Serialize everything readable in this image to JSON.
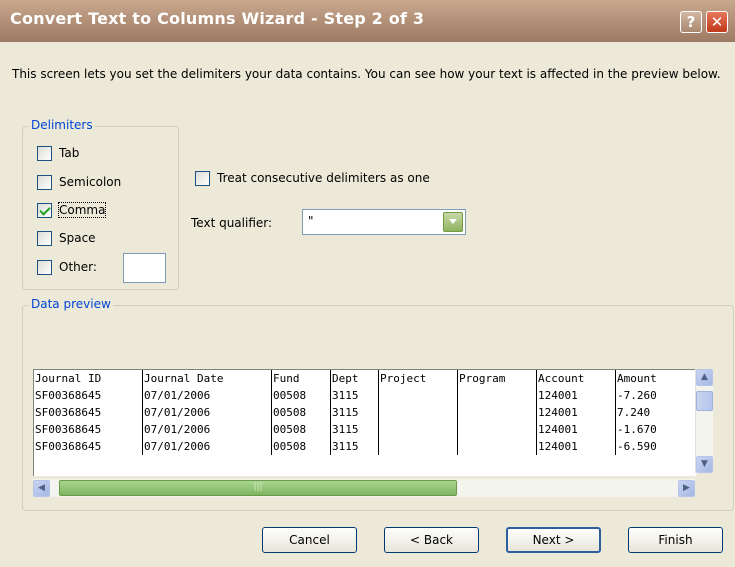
{
  "window": {
    "title": "Convert Text to Columns Wizard - Step 2 of 3",
    "help_label": "?",
    "close_label": "✕"
  },
  "intro_text": "This screen lets you set the delimiters your data contains.  You can see how your text is affected in the preview below.",
  "delimiters": {
    "legend": "Delimiters",
    "items": [
      {
        "label": "Tab",
        "checked": false
      },
      {
        "label": "Semicolon",
        "checked": false
      },
      {
        "label": "Comma",
        "checked": true
      },
      {
        "label": "Space",
        "checked": false
      },
      {
        "label": "Other:",
        "checked": false
      }
    ],
    "other_value": ""
  },
  "consecutive": {
    "label": "Treat consecutive delimiters as one",
    "checked": false
  },
  "text_qualifier": {
    "label": "Text qualifier:",
    "value": "\""
  },
  "data_preview": {
    "legend": "Data preview",
    "columns": [
      "Journal ID",
      "Journal Date",
      "Fund",
      "Dept",
      "Project",
      "Program",
      "Account",
      "Amount"
    ],
    "rows": [
      [
        "SF00368645",
        "07/01/2006",
        "00508",
        "3115",
        "",
        "",
        "124001",
        "-7.260"
      ],
      [
        "SF00368645",
        "07/01/2006",
        "00508",
        "3115",
        "",
        "",
        "124001",
        "7.240"
      ],
      [
        "SF00368645",
        "07/01/2006",
        "00508",
        "3115",
        "",
        "",
        "124001",
        "-1.670"
      ],
      [
        "SF00368645",
        "07/01/2006",
        "00508",
        "3115",
        "",
        "",
        "124001",
        "-6.590"
      ]
    ]
  },
  "buttons": {
    "cancel": "Cancel",
    "back": "< Back",
    "next": "Next >",
    "finish": "Finish"
  }
}
